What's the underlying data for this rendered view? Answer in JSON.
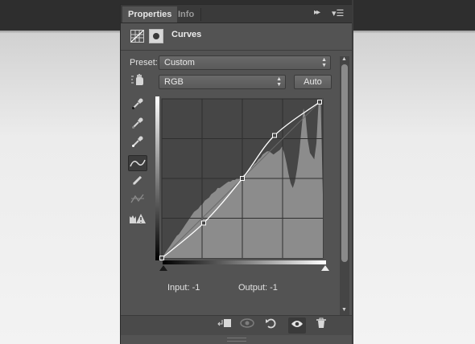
{
  "panel": {
    "tabs": [
      {
        "label": "Properties"
      },
      {
        "label": "Info"
      }
    ],
    "collapse_glyph": "▸▸",
    "menu_glyph": "▾☰",
    "title": "Curves",
    "preset": {
      "label": "Preset:",
      "value": "Custom"
    },
    "channel": {
      "value": "RGB"
    },
    "auto_label": "Auto",
    "input_label": "Input:",
    "input_value": "-1",
    "output_label": "Output:",
    "output_value": "-1"
  },
  "curve": {
    "points": [
      [
        0,
        0
      ],
      [
        0.26,
        0.22
      ],
      [
        0.5,
        0.5
      ],
      [
        0.7,
        0.77
      ],
      [
        0.98,
        0.98
      ]
    ],
    "histogram": [
      0,
      2,
      4,
      6,
      8,
      10,
      12,
      14,
      15,
      17,
      19,
      21,
      23,
      25,
      27,
      29,
      30,
      31,
      33,
      34,
      36,
      37,
      38,
      40,
      41,
      42,
      44,
      44,
      45,
      46,
      47,
      48,
      48,
      49,
      49,
      50,
      50,
      51,
      52,
      53,
      54,
      56,
      57,
      59,
      60,
      62,
      63,
      65,
      66,
      67,
      67,
      66,
      65,
      66,
      67,
      68,
      70,
      66,
      60,
      53,
      47,
      44,
      48,
      56,
      66,
      80,
      94,
      88,
      74,
      66,
      64,
      62,
      72,
      98,
      100,
      40
    ]
  }
}
